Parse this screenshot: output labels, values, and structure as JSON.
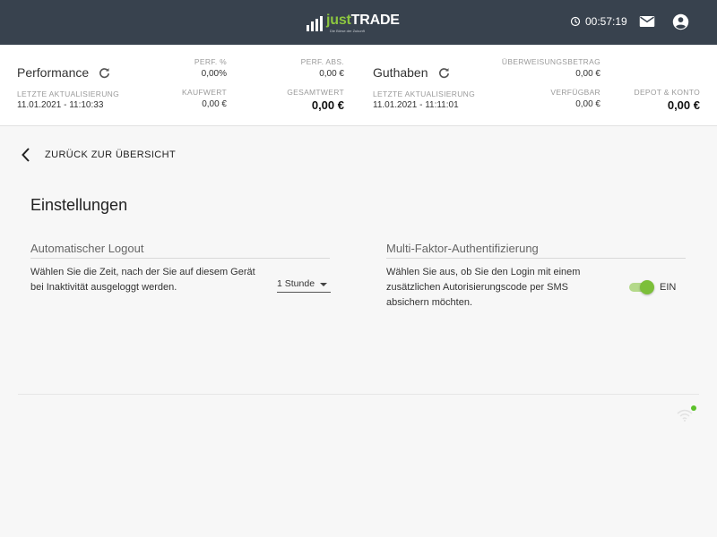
{
  "header": {
    "logo": {
      "just": "just",
      "trade": "TRADE",
      "tagline": "Die Börse der Zukunft"
    },
    "timer": "00:57:19",
    "icons": {
      "clock": "clock-icon",
      "mail": "mail-icon",
      "account": "account-circle-icon"
    }
  },
  "summary": {
    "performance": {
      "title": "Performance",
      "updated_label": "LETZTE AKTUALISIERUNG",
      "updated_value": "11.01.2021 - 11:10:33",
      "perf_pct_label": "PERF. %",
      "perf_pct_value": "0,00%",
      "perf_abs_label": "PERF. ABS.",
      "perf_abs_value": "0,00 €",
      "kaufwert_label": "KAUFWERT",
      "kaufwert_value": "0,00 €",
      "gesamtwert_label": "GESAMTWERT",
      "gesamtwert_value": "0,00 €"
    },
    "guthaben": {
      "title": "Guthaben",
      "updated_label": "LETZTE AKTUALISIERUNG",
      "updated_value": "11.01.2021 - 11:11:01",
      "ueberweisung_label": "ÜBERWEISUNGSBETRAG",
      "ueberweisung_value": "0,00 €",
      "verfuegbar_label": "VERFÜGBAR",
      "verfuegbar_value": "0,00 €",
      "depot_label": "DEPOT & KONTO",
      "depot_value": "0,00 €"
    }
  },
  "nav": {
    "back_label": "ZURÜCK ZUR ÜBERSICHT"
  },
  "main": {
    "title": "Einstellungen",
    "logout": {
      "title": "Automatischer Logout",
      "text_line1": "Wählen Sie die Zeit, nach der Sie auf diesem Gerät",
      "text_line2": "bei Inaktivität ausgeloggt werden.",
      "selected": "1 Stunde"
    },
    "mfa": {
      "title": "Multi-Faktor-Authentifizierung",
      "text_line1": "Wählen Sie aus, ob Sie den Login mit einem",
      "text_line2": "zusätzlichen Autorisierungscode per SMS",
      "text_line3": "absichern möchten.",
      "toggle_on": true,
      "toggle_label": "EIN"
    }
  },
  "colors": {
    "accent": "#7cbf3a",
    "topbar": "#38424e",
    "online": "#5cc12a"
  }
}
